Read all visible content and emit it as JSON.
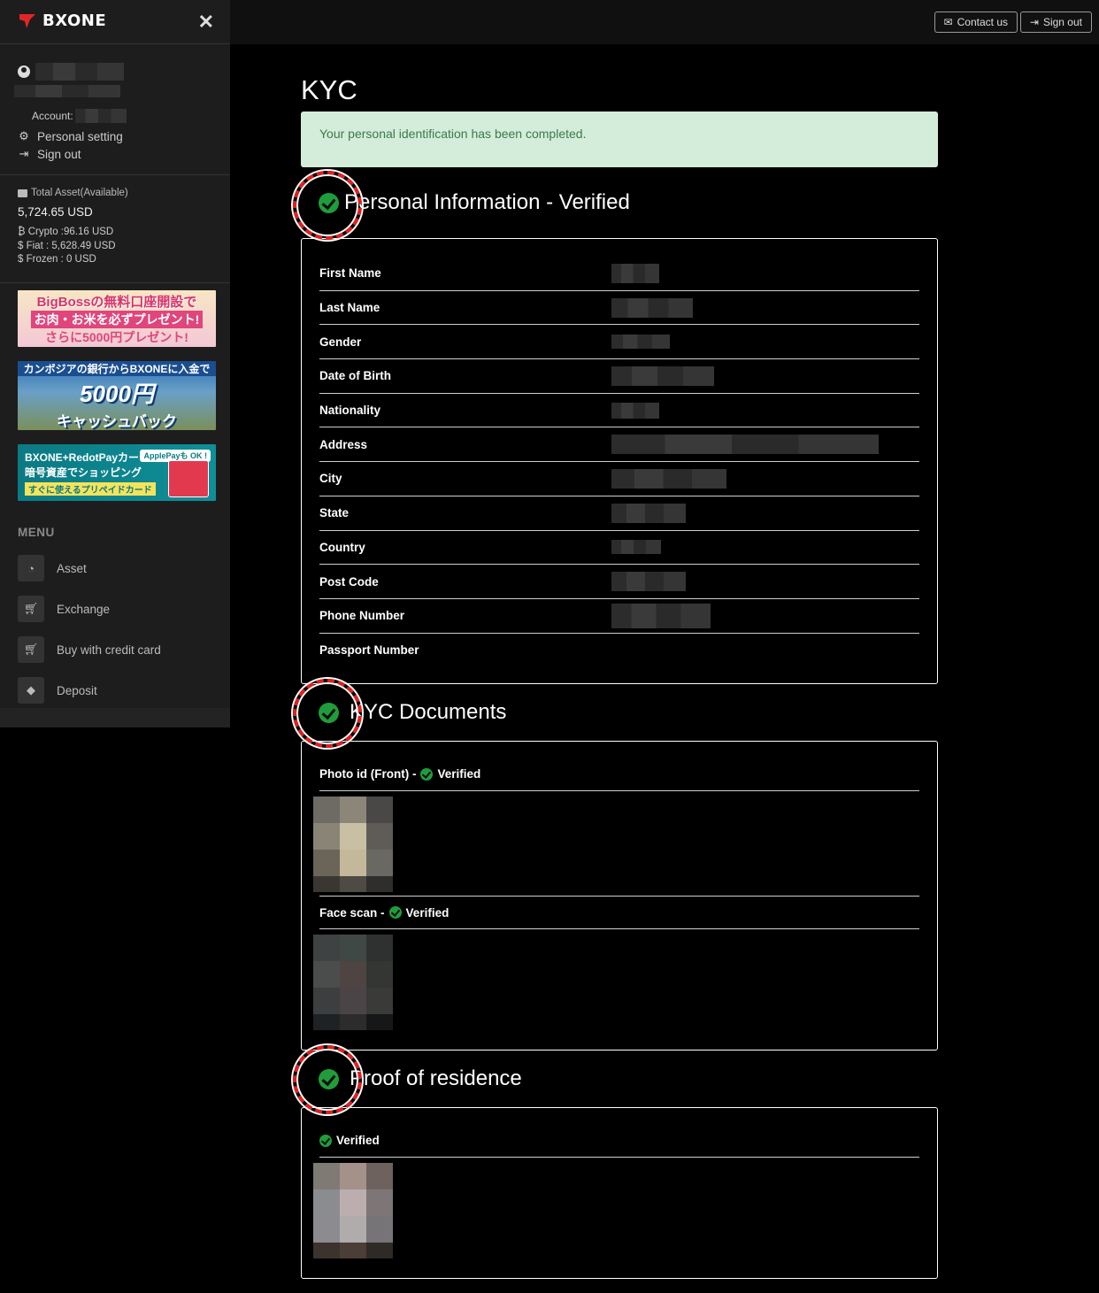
{
  "brand": {
    "name": "BXONE"
  },
  "sidebar": {
    "account_label": "Account:",
    "personal_setting": "Personal setting",
    "sign_out": "Sign out",
    "asset_title": "Total Asset(Available)",
    "asset_total": "5,724.65 USD",
    "crypto": "Crypto :96.16 USD",
    "fiat": "Fiat : 5,628.49 USD",
    "frozen": "Frozen : 0 USD",
    "banners": [
      {
        "l1": "BigBossの無料口座開設で",
        "l2": "お肉・お米を必ずプレゼント!",
        "l3": "さらに5000円プレゼント!"
      },
      {
        "l1": "カンボジアの銀行からBXONEに入金で",
        "l2": "5000円",
        "l3": "キャッシュバック"
      },
      {
        "l1": "BXONE+RedotPayカード",
        "l2": "暗号資産でショッピング",
        "l3": "すぐに使えるプリペイドカード",
        "badge": "ApplePayも OK !"
      }
    ],
    "menu_title": "MENU",
    "menu": [
      {
        "label": "Asset",
        "icon": "dashboard-icon"
      },
      {
        "label": "Exchange",
        "icon": "cart-icon"
      },
      {
        "label": "Buy with credit card",
        "icon": "cart-icon"
      },
      {
        "label": "Deposit",
        "icon": "diamond-icon"
      }
    ]
  },
  "topbar": {
    "contact": "Contact us",
    "signout": "Sign out"
  },
  "main": {
    "title": "KYC",
    "alert": "Your personal identification has been completed.",
    "personal_title": "Personal Information - Verified",
    "fields": [
      "First Name",
      "Last Name",
      "Gender",
      "Date of Birth",
      "Nationality",
      "Address",
      "City",
      "State",
      "Country",
      "Post Code",
      "Phone Number",
      "Passport Number"
    ],
    "docs_title": "KYC Documents",
    "photo_front": "Photo id (Front) -",
    "face_scan": "Face scan -",
    "verified": "Verified",
    "residence_title": "Proof of residence"
  },
  "colors": {
    "accent_green": "#1f9d3a",
    "alert_bg": "#d4ecda",
    "alert_text": "#3a7a4a",
    "highlight_ring": "#e02020"
  }
}
